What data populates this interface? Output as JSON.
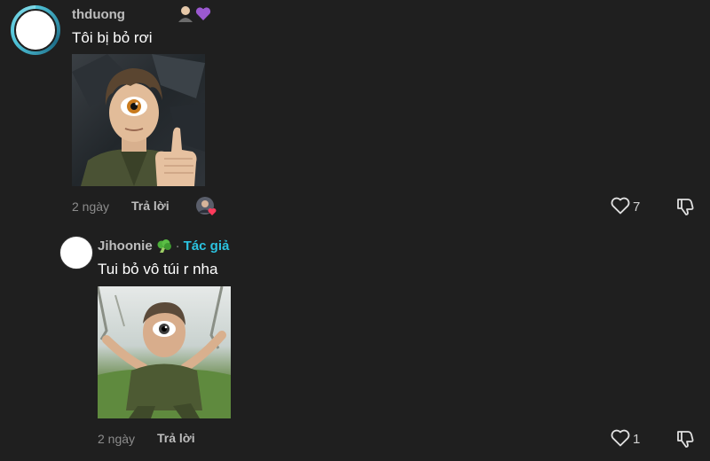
{
  "comments": [
    {
      "username": "thduong",
      "text": "Tôi bị bỏ rơi",
      "time": "2 ngày",
      "reply_label": "Trả lời",
      "likes": "7"
    }
  ],
  "reply": {
    "username": "Jihoonie",
    "separator": "·",
    "author_label": "Tác giả",
    "text": "Tui bỏ vô túi r nha",
    "time": "2 ngày",
    "reply_label": "Trả lời",
    "likes": "1"
  },
  "colors": {
    "background": "#1f1f1f",
    "author_badge": "#2bc3e0",
    "username": "#bdbdbd",
    "meta": "#8c8c8c"
  },
  "icons": {
    "heart": "heart-outline-icon",
    "dislike": "thumbs-down-outline-icon",
    "emoji_badges": [
      "person-emoji-icon",
      "purple-heart-icon"
    ],
    "broccoli": "broccoli-emoji-icon"
  }
}
